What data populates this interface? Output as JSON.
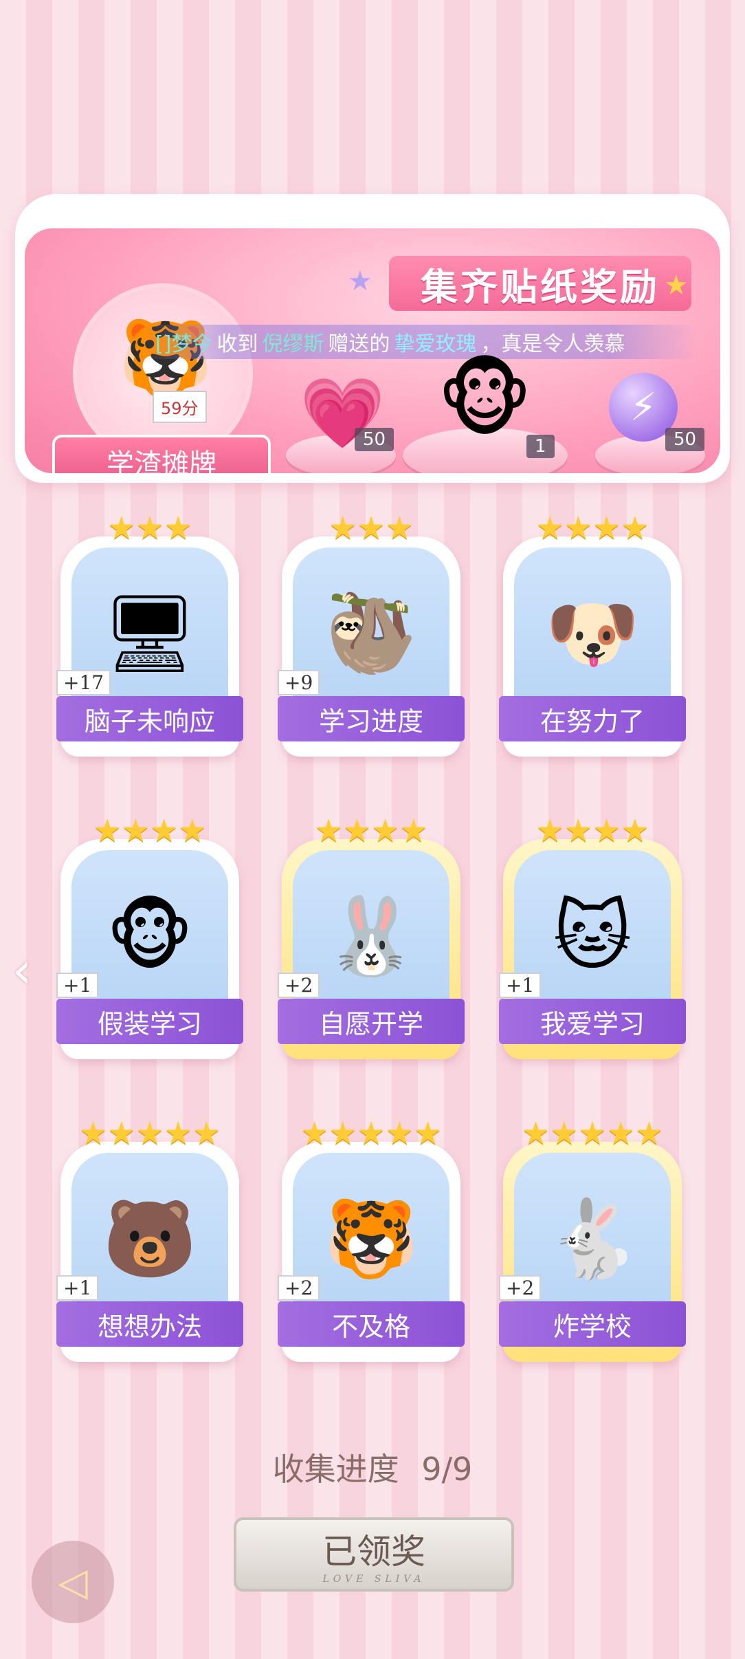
{
  "banner": {
    "title": "集齐贴纸奖励",
    "ticker": {
      "user": "[]梦今",
      "text1": "收到",
      "sender": "倪缪斯",
      "text2": "赠送的",
      "gift": "挚爱玫瑰",
      "text3": "，真是令人羡慕"
    },
    "avatar_label": "学渣摊牌",
    "avatar_paper": "59分",
    "rewards": [
      {
        "name": "heart-gem",
        "count": "50"
      },
      {
        "name": "monkey-sticker",
        "count": "1"
      },
      {
        "name": "energy-orb",
        "count": "50"
      }
    ]
  },
  "cards": [
    {
      "title": "脑子未响应",
      "badge": "+17",
      "stars": "★★★",
      "icon": "🖥",
      "gold": false
    },
    {
      "title": "学习进度",
      "badge": "+9",
      "stars": "★★★",
      "icon": "🦥",
      "gold": false
    },
    {
      "title": "在努力了",
      "badge": "",
      "stars": "★★★★",
      "icon": "🐶",
      "gold": false
    },
    {
      "title": "假装学习",
      "badge": "+1",
      "stars": "★★★★",
      "icon": "🐵",
      "gold": false
    },
    {
      "title": "自愿开学",
      "badge": "+2",
      "stars": "★★★★",
      "icon": "🐰",
      "gold": true
    },
    {
      "title": "我爱学习",
      "badge": "+1",
      "stars": "★★★★",
      "icon": "🐱",
      "gold": true
    },
    {
      "title": "想想办法",
      "badge": "+1",
      "stars": "★★★★★",
      "icon": "🐻",
      "gold": false
    },
    {
      "title": "不及格",
      "badge": "+2",
      "stars": "★★★★★",
      "icon": "🐯",
      "gold": false
    },
    {
      "title": "炸学校",
      "badge": "+2",
      "stars": "★★★★★",
      "icon": "🐇",
      "gold": true
    }
  ],
  "progress": {
    "label": "收集进度",
    "value": "9/9"
  },
  "claim_button": {
    "label": "已领奖",
    "sub": "LOVE SLIVA"
  }
}
